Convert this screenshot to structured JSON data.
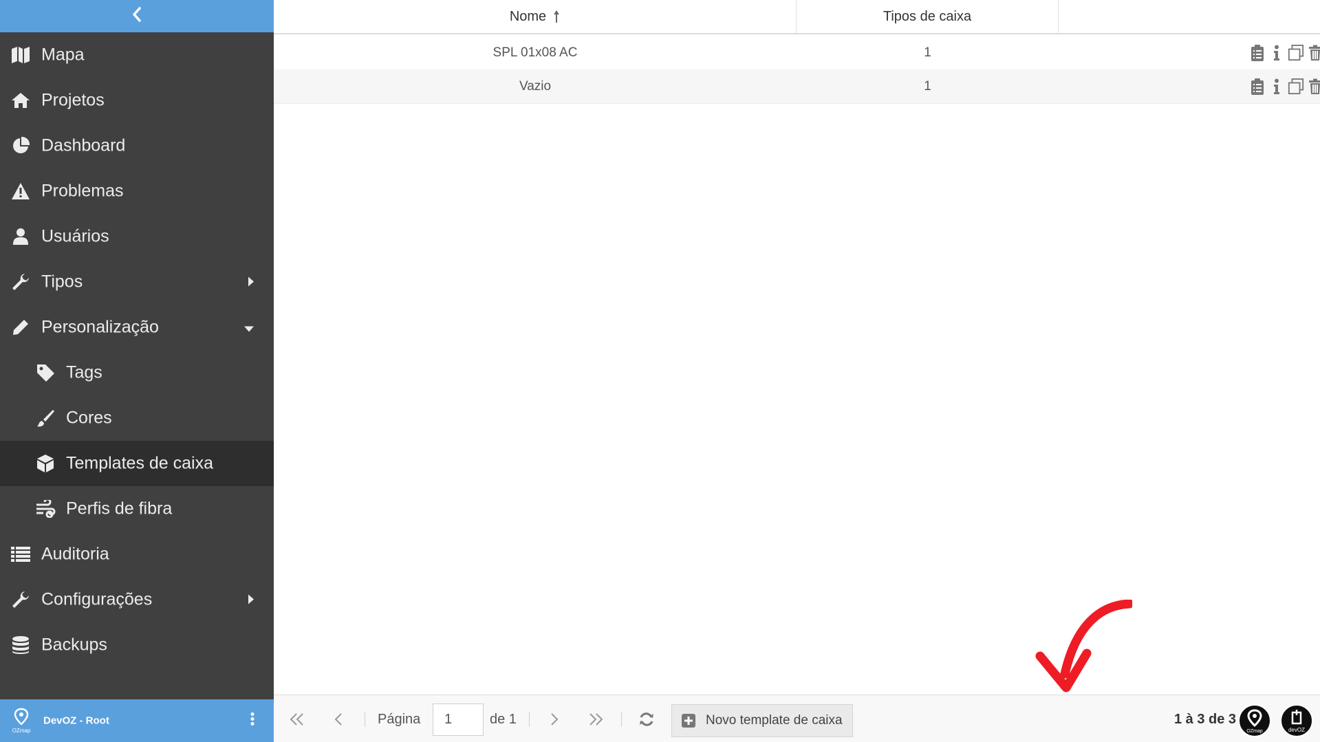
{
  "sidebar": {
    "collapse_icon": "chevron-left-icon",
    "items": [
      {
        "label": "Mapa",
        "icon": "map-icon"
      },
      {
        "label": "Projetos",
        "icon": "home-icon"
      },
      {
        "label": "Dashboard",
        "icon": "pie-chart-icon"
      },
      {
        "label": "Problemas",
        "icon": "warning-icon"
      },
      {
        "label": "Usuários",
        "icon": "user-icon"
      },
      {
        "label": "Tipos",
        "icon": "wrench-icon",
        "caret": "caret-right-icon"
      },
      {
        "label": "Personalização",
        "icon": "pencil-icon",
        "caret": "caret-down-icon",
        "expanded": true
      },
      {
        "label": "Tags",
        "icon": "tag-icon",
        "sub": true
      },
      {
        "label": "Cores",
        "icon": "paint-brush-icon",
        "sub": true
      },
      {
        "label": "Templates de caixa",
        "icon": "cube-icon",
        "sub": true,
        "active": true
      },
      {
        "label": "Perfis de fibra",
        "icon": "fiber-icon",
        "sub": true
      },
      {
        "label": "Auditoria",
        "icon": "list-icon"
      },
      {
        "label": "Configurações",
        "icon": "wrench-icon",
        "caret": "caret-right-icon"
      },
      {
        "label": "Backups",
        "icon": "database-icon"
      }
    ],
    "user": {
      "name": "DevOZ - Root",
      "logo_text": "OZmap"
    }
  },
  "table": {
    "columns": [
      "Nome",
      "Tipos de caixa",
      ""
    ],
    "sort": {
      "column": "Nome",
      "direction": "ascending"
    },
    "rows": [
      {
        "nome": "SPL 01x08 AC",
        "tipos": "1"
      },
      {
        "nome": "Vazio",
        "tipos": "1"
      }
    ],
    "row_actions": [
      "clipboard-icon",
      "info-icon",
      "copy-icon",
      "trash-icon"
    ]
  },
  "pager": {
    "page_label": "Página",
    "page_value": "1",
    "of_label": "de 1",
    "new_button_label": "Novo template de caixa",
    "count_text": "1 à 3 de 3",
    "badge_left_text": "OZmap",
    "badge_right_text": "devOZ"
  },
  "colors": {
    "sidebar_bg": "#404040",
    "sidebar_active": "#2e2e2e",
    "accent_blue": "#5aa0dd",
    "annotation_red": "#ee1c24"
  }
}
